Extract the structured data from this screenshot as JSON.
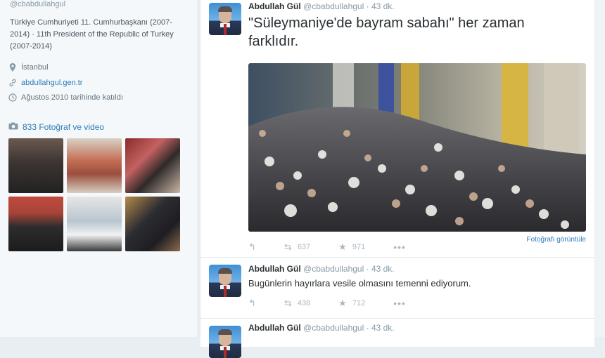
{
  "profile": {
    "handle": "@cbabdullahgul",
    "bio": "Türkiye Cumhuriyeti 11. Cumhurbaşkanı (2007-2014) · 11th President of the Republic of Turkey (2007-2014)",
    "location": "İstanbul",
    "website": "abdullahgul.gen.tr",
    "joined": "Ağustos 2010 tarihinde katıldı",
    "photos_label": "833 Fotoğraf ve video",
    "icons": {
      "location": "location-pin-icon",
      "website": "link-icon",
      "joined": "calendar-icon",
      "photos": "camera-icon"
    }
  },
  "tweets": [
    {
      "name": "Abdullah Gül",
      "handle": "@cbabdullahgul",
      "time": "· 43 dk.",
      "text": "\"Süleymaniye'de bayram sabahı\" her zaman farklıdır.",
      "retweets": "637",
      "likes": "971",
      "view_link": "Fotoğrafı görüntüle"
    },
    {
      "name": "Abdullah Gül",
      "handle": "@cbabdullahgul",
      "time": "· 43 dk.",
      "text": "Bugünlerin hayırlara vesile olmasını temenni ediyorum.",
      "retweets": "438",
      "likes": "712"
    },
    {
      "name": "Abdullah Gül",
      "handle": "@cbabdullahgul",
      "time": "· 43 dk."
    }
  ],
  "more_glyph": "•••",
  "colors": {
    "link": "#2b7bb9",
    "muted": "#8899a6",
    "text": "#292f33"
  }
}
